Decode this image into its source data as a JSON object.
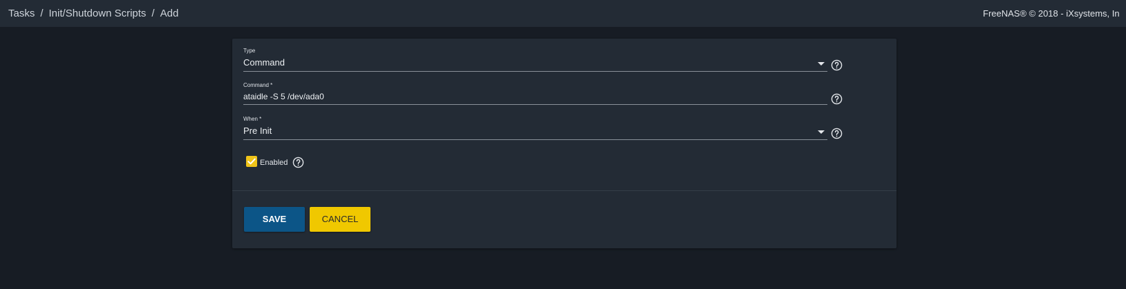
{
  "breadcrumb": {
    "items": [
      "Tasks",
      "Init/Shutdown Scripts",
      "Add"
    ],
    "separator": "/"
  },
  "footer_text": "FreeNAS® © 2018 - iXsystems, In",
  "form": {
    "type": {
      "label": "Type",
      "value": "Command",
      "control": "select"
    },
    "command": {
      "label": "Command *",
      "value": "ataidle -S 5 /dev/ada0",
      "control": "text-input"
    },
    "when": {
      "label": "When *",
      "value": "Pre Init",
      "control": "select"
    },
    "enabled": {
      "label": "Enabled",
      "checked": true
    }
  },
  "buttons": {
    "save_label": "SAVE",
    "cancel_label": "CANCEL"
  },
  "icons": {
    "help": "help-circle-icon",
    "dropdown": "dropdown-arrow-icon",
    "check": "check-icon"
  },
  "colors": {
    "background": "#171c24",
    "surface": "#232b35",
    "primary": "#0c5587",
    "accent": "#f0c800",
    "text": "#e3e6ea"
  }
}
